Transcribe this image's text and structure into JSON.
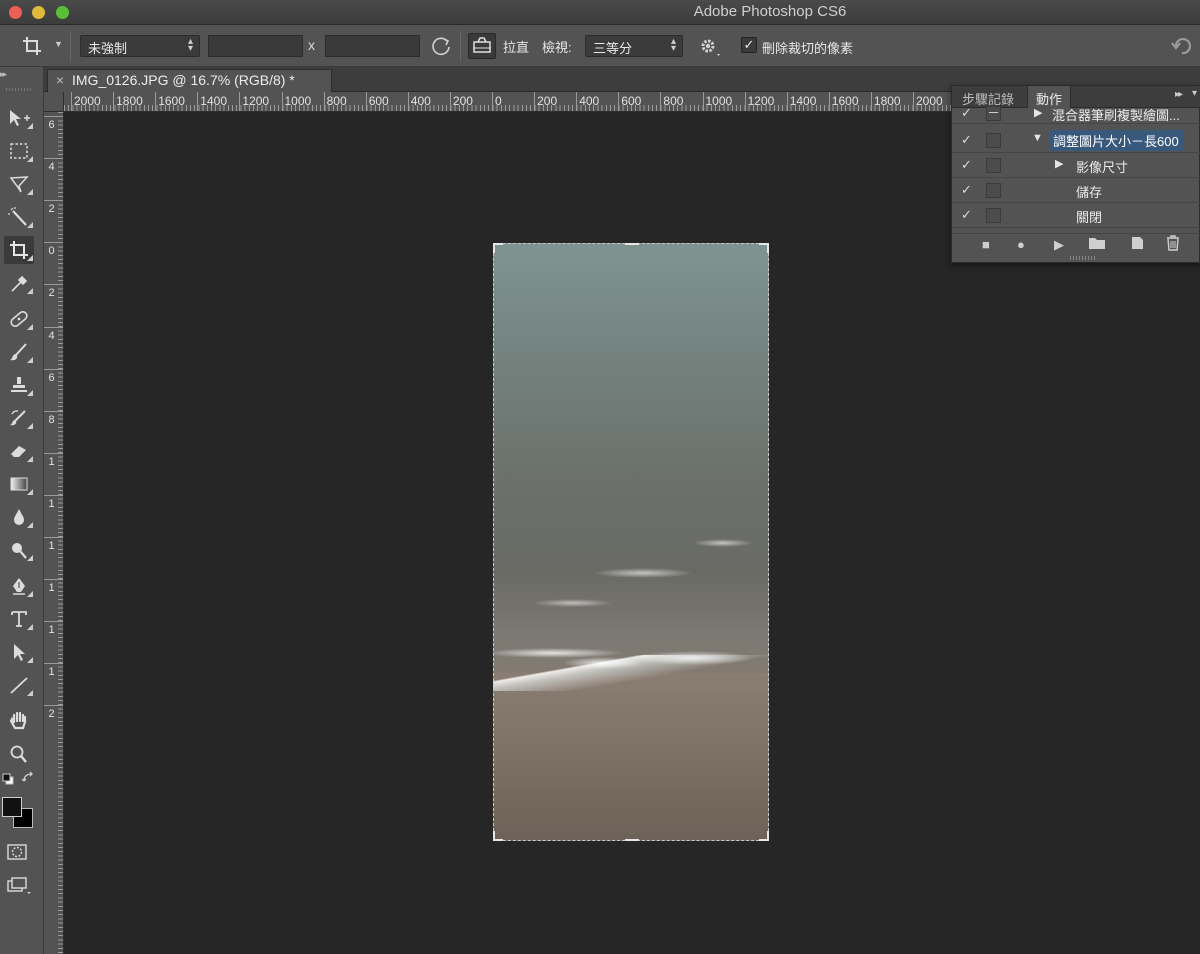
{
  "window": {
    "title": "Adobe Photoshop CS6"
  },
  "options": {
    "ratio_select": "未強制",
    "width_value": "",
    "height_value": "",
    "swap_label": "x",
    "straighten_label": "拉直",
    "view_label": "檢視:",
    "view_select": "三等分",
    "delete_cropped_label": "刪除裁切的像素",
    "delete_cropped_checked": true,
    "check_glyph": "✓"
  },
  "document": {
    "tab_title": "IMG_0126.JPG @ 16.7% (RGB/8) *",
    "close_glyph": "×"
  },
  "rulers": {
    "horizontal": [
      "2000",
      "1800",
      "1600",
      "1400",
      "1200",
      "1000",
      "800",
      "600",
      "400",
      "200",
      "0",
      "200",
      "400",
      "600",
      "800",
      "1000",
      "1200",
      "1400",
      "1600",
      "1800",
      "2000"
    ],
    "vertical": [
      "6",
      "4",
      "2",
      "0",
      "2",
      "4",
      "6",
      "8",
      "1",
      "1",
      "1",
      "1",
      "1",
      "1",
      "2"
    ]
  },
  "panel": {
    "tabs": [
      "步驟記錄",
      "動作"
    ],
    "active_tab": "動作",
    "rows": [
      {
        "label": "混合器筆刷複製繪圖...",
        "checked": true,
        "expanded": false,
        "selected": false
      },
      {
        "label": "調整圖片大小－長600",
        "checked": true,
        "expanded": true,
        "selected": true
      },
      {
        "label": "影像尺寸",
        "checked": true,
        "expanded": false,
        "selected": false
      },
      {
        "label": "儲存",
        "checked": true,
        "expanded": null,
        "selected": false
      },
      {
        "label": "關閉",
        "checked": true,
        "expanded": null,
        "selected": false
      }
    ]
  },
  "icons": {
    "crop": "crop-icon",
    "move": "move-icon",
    "marquee": "marquee-icon",
    "lasso": "lasso-icon",
    "magic_wand": "magic-wand-icon",
    "eyedropper": "eyedropper-icon",
    "healing": "healing-brush-icon",
    "brush": "brush-icon",
    "stamp": "clone-stamp-icon",
    "history_brush": "history-brush-icon",
    "eraser": "eraser-icon",
    "gradient": "gradient-icon",
    "blur": "blur-icon",
    "dodge": "dodge-icon",
    "pen": "pen-icon",
    "type": "type-icon",
    "path_select": "path-selection-icon",
    "line": "line-icon",
    "hand": "hand-icon",
    "zoom": "zoom-icon"
  },
  "colors": {
    "chrome": "#535353",
    "canvas_bg": "#262626",
    "selection": "#39597c",
    "foreground_swatch": "#111111",
    "background_swatch": "#000000"
  }
}
